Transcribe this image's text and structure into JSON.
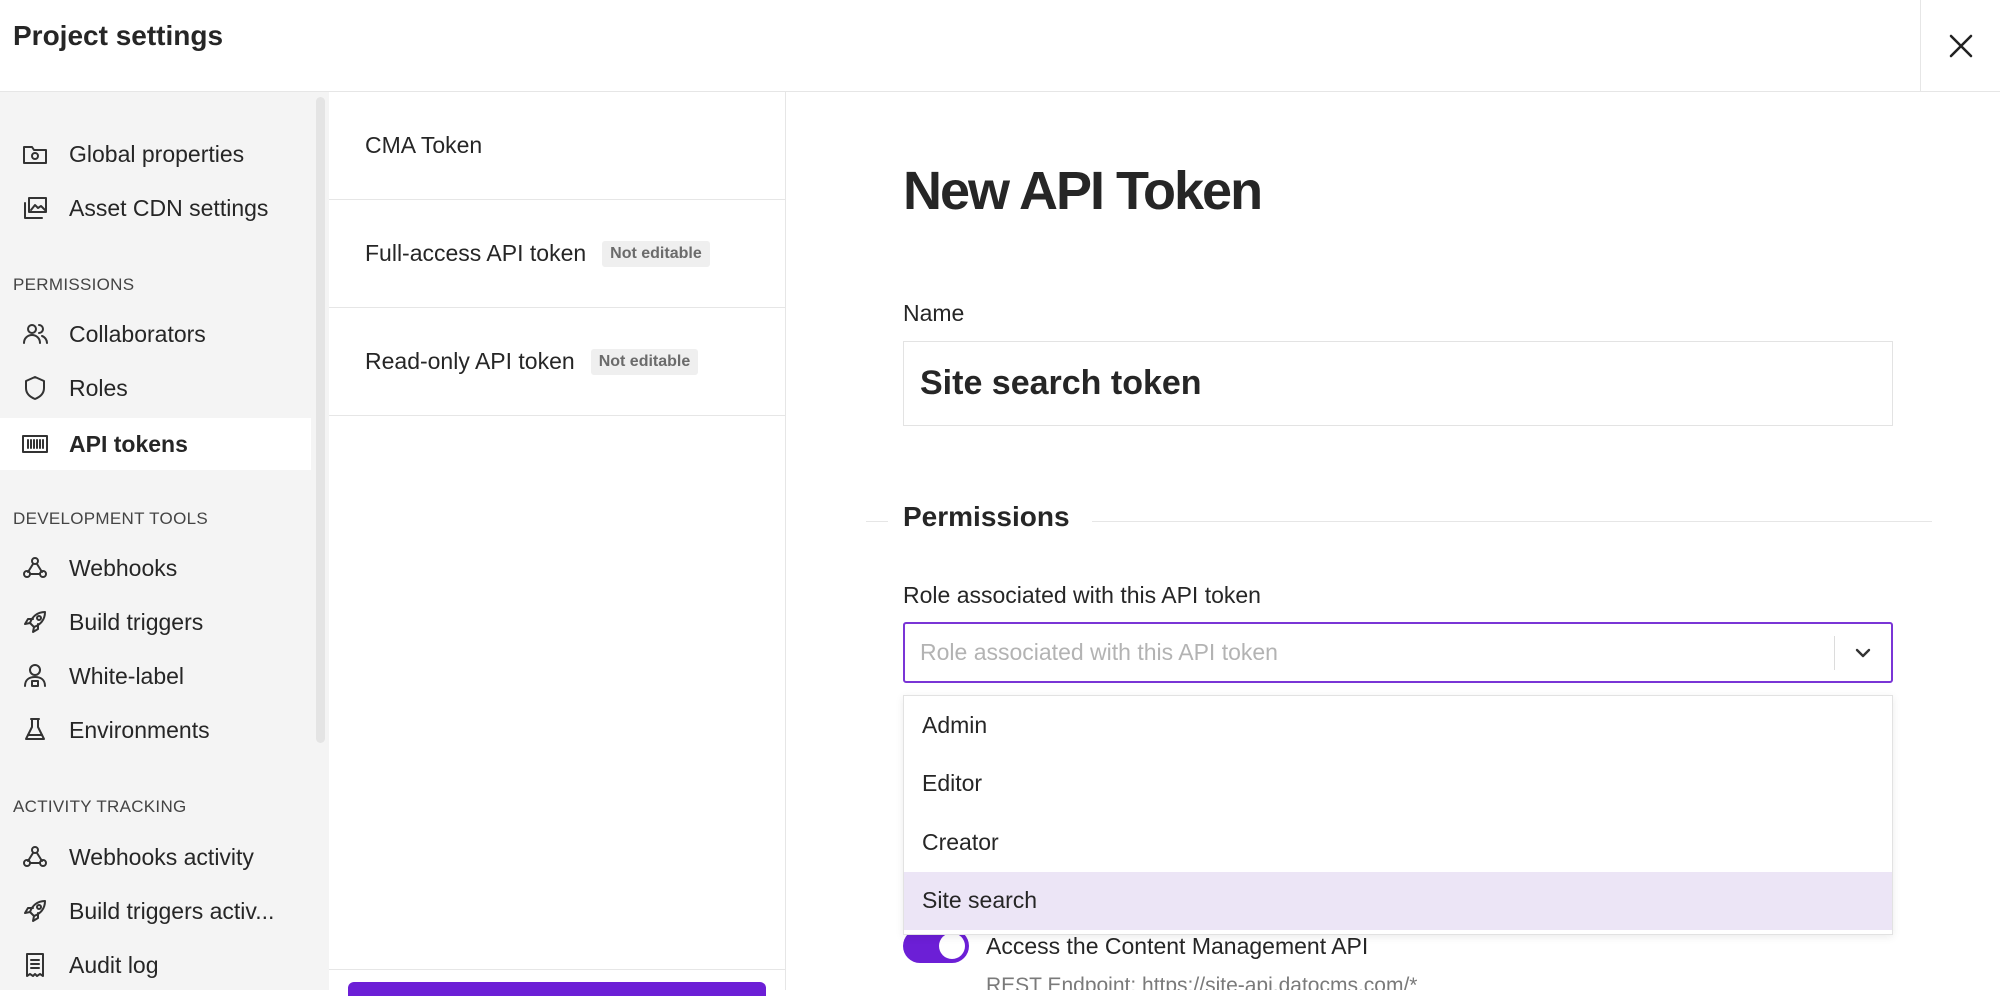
{
  "header": {
    "title": "Project settings"
  },
  "sidebar": {
    "top_items": [
      {
        "label": "Global properties",
        "icon": "folder-gear-icon"
      },
      {
        "label": "Asset CDN settings",
        "icon": "images-icon"
      }
    ],
    "sections": [
      {
        "heading": "PERMISSIONS",
        "items": [
          {
            "label": "Collaborators",
            "icon": "users-icon"
          },
          {
            "label": "Roles",
            "icon": "shield-icon"
          },
          {
            "label": "API tokens",
            "icon": "barcode-icon",
            "active": true
          }
        ]
      },
      {
        "heading": "DEVELOPMENT TOOLS",
        "items": [
          {
            "label": "Webhooks",
            "icon": "webhook-icon"
          },
          {
            "label": "Build triggers",
            "icon": "rocket-icon"
          },
          {
            "label": "White-label",
            "icon": "user-badge-icon"
          },
          {
            "label": "Environments",
            "icon": "flask-icon"
          }
        ]
      },
      {
        "heading": "ACTIVITY TRACKING",
        "items": [
          {
            "label": "Webhooks activity",
            "icon": "webhook-icon"
          },
          {
            "label": "Build triggers activ...",
            "icon": "rocket-icon"
          },
          {
            "label": "Audit log",
            "icon": "receipt-icon"
          }
        ]
      }
    ]
  },
  "token_list": {
    "items": [
      {
        "label": "CMA Token",
        "badge": ""
      },
      {
        "label": "Full-access API token",
        "badge": "Not editable"
      },
      {
        "label": "Read-only API token",
        "badge": "Not editable"
      }
    ]
  },
  "main": {
    "title": "New API Token",
    "name_label": "Name",
    "name_value": "Site search token",
    "permissions_title": "Permissions",
    "role_label": "Role associated with this API token",
    "role_placeholder": "Role associated with this API token",
    "role_options": [
      "Admin",
      "Editor",
      "Creator",
      "Site search"
    ],
    "highlighted_option": "Site search",
    "cma_toggle_label": "Access the Content Management API",
    "cma_toggle_hint": "REST Endpoint: https://site-api.datocms.com/*",
    "cma_toggle_on": true
  },
  "colors": {
    "accent": "#6c1fd6",
    "select_border": "#7a35d6",
    "highlight": "#ece5f6",
    "sidebar_bg": "#f4f4f4"
  }
}
